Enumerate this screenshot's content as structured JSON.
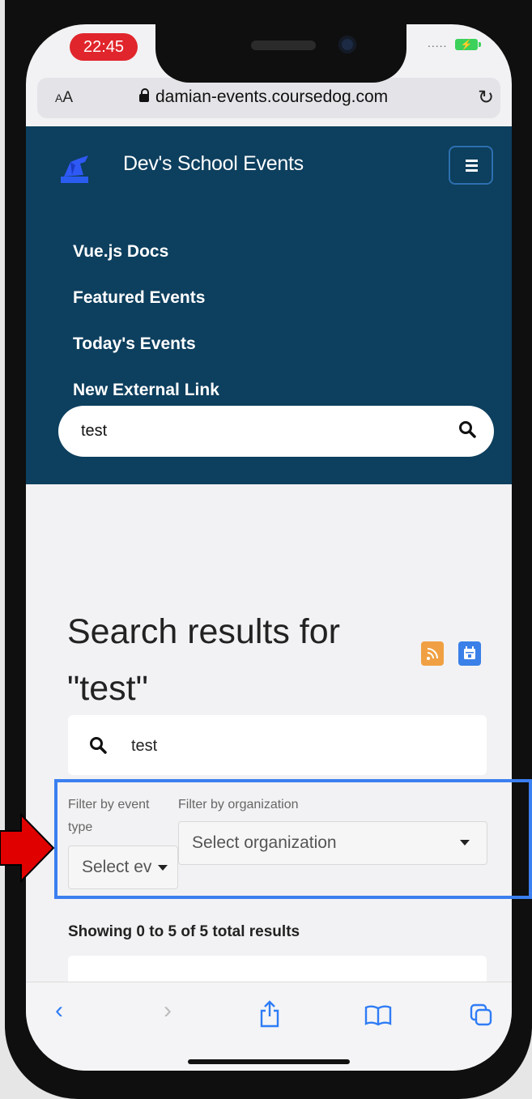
{
  "status_bar": {
    "time": "22:45",
    "signal_dots": "....."
  },
  "browser": {
    "text_size_label": "AA",
    "url": "damian-events.coursedog.com",
    "reload_icon": "reload-icon"
  },
  "header": {
    "title": "Dev's School Events",
    "nav": [
      "Vue.js Docs",
      "Featured Events",
      "Today's Events",
      "New External Link"
    ],
    "search_value": "test"
  },
  "main": {
    "title_line1": "Search results for",
    "title_line2": "\"test\"",
    "search_value": "test",
    "filter_event_label_1": "Filter by event",
    "filter_event_label_2": "type",
    "filter_event_value": "Select ev",
    "filter_org_label": "Filter by organization",
    "filter_org_value": "Select organization",
    "results_summary": "Showing 0 to 5 of 5 total results"
  },
  "colors": {
    "header_bg": "#0d3f5e",
    "accent_blue": "#3a80e8",
    "rss_orange": "#f0a042",
    "time_pill": "#e0262c",
    "highlight": "#3b7ff0",
    "arrow": "#e00000"
  }
}
